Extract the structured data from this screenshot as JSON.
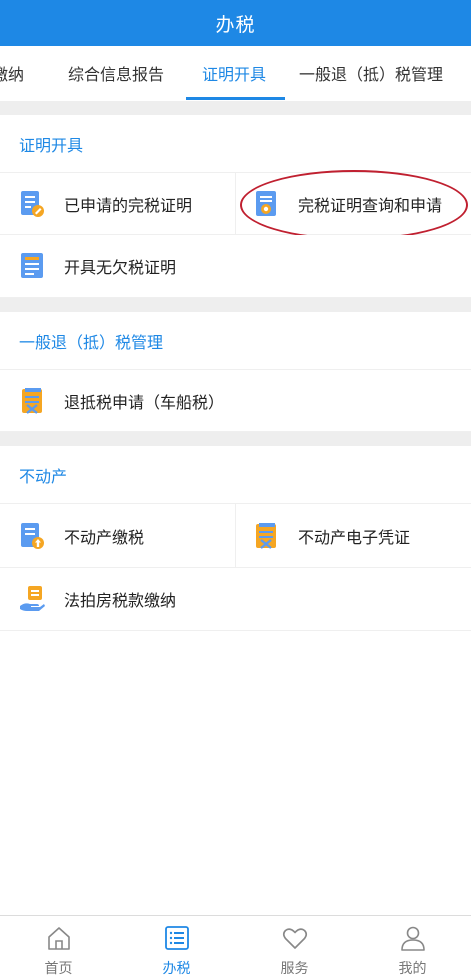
{
  "header": {
    "title": "办税"
  },
  "tabs": [
    {
      "label": "缴纳"
    },
    {
      "label": "综合信息报告"
    },
    {
      "label": "证明开具",
      "active": true
    },
    {
      "label": "一般退（抵）税管理"
    }
  ],
  "sections": {
    "certificate": {
      "title": "证明开具",
      "items": [
        {
          "label": "已申请的完税证明",
          "icon": "document-edit-icon"
        },
        {
          "label": "完税证明查询和申请",
          "icon": "document-seal-icon"
        },
        {
          "label": "开具无欠税证明",
          "icon": "document-list-icon"
        }
      ]
    },
    "refund": {
      "title": "一般退（抵）税管理",
      "items": [
        {
          "label": "退抵税申请（车船税）",
          "icon": "document-cross-icon"
        }
      ]
    },
    "realestate": {
      "title": "不动产",
      "items": [
        {
          "label": "不动产缴税",
          "icon": "document-upload-icon"
        },
        {
          "label": "不动产电子凭证",
          "icon": "document-cross-icon"
        },
        {
          "label": "法拍房税款缴纳",
          "icon": "tax-hand-icon"
        }
      ]
    }
  },
  "bottom_nav": [
    {
      "label": "首页",
      "icon": "home-icon"
    },
    {
      "label": "办税",
      "icon": "list-icon",
      "active": true
    },
    {
      "label": "服务",
      "icon": "heart-icon"
    },
    {
      "label": "我的",
      "icon": "user-icon"
    }
  ],
  "colors": {
    "primary": "#1e88e5",
    "icon_blue": "#5b9bf0",
    "icon_orange": "#f5a623",
    "annotation_red": "#c02030"
  }
}
